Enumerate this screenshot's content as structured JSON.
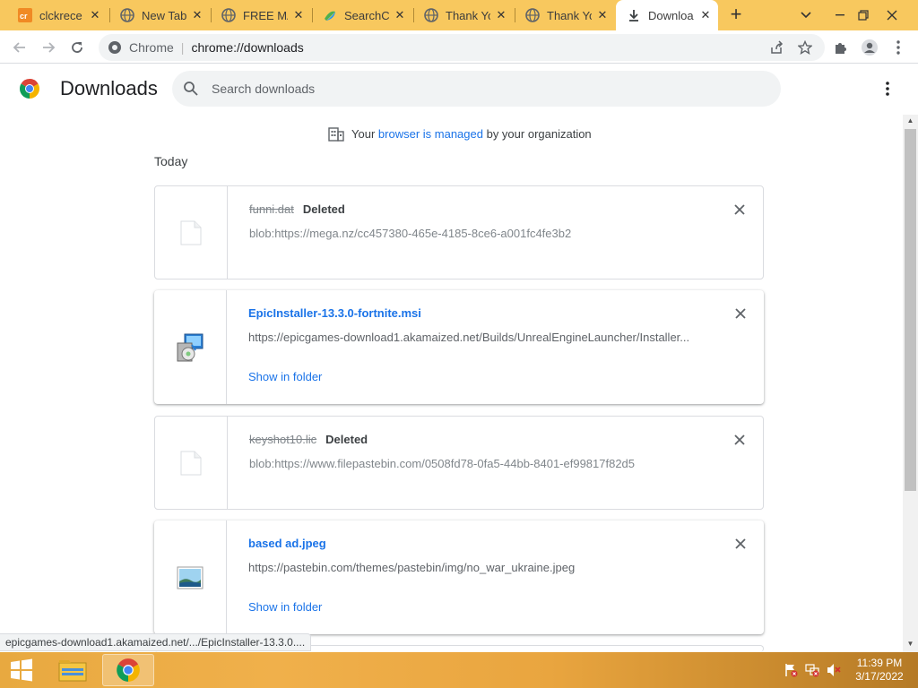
{
  "tabs": [
    {
      "title": "clckrece",
      "favicon": "cr-icon"
    },
    {
      "title": "New Tab",
      "favicon": "globe-icon"
    },
    {
      "title": "FREE MA",
      "favicon": "globe-icon"
    },
    {
      "title": "SearchCo",
      "favicon": "searchco-icon"
    },
    {
      "title": "Thank Yo",
      "favicon": "globe-icon"
    },
    {
      "title": "Thank Yo",
      "favicon": "globe-icon"
    },
    {
      "title": "Downloa",
      "favicon": "download-icon",
      "active": true
    }
  ],
  "omnibox": {
    "scheme_label": "Chrome",
    "separator": "|",
    "url": "chrome://downloads"
  },
  "header": {
    "title": "Downloads",
    "search_placeholder": "Search downloads"
  },
  "managed": {
    "prefix": "Your",
    "link": "browser is managed",
    "suffix": "by your organization"
  },
  "section_label": "Today",
  "downloads": [
    {
      "filename": "funni.dat",
      "status": "Deleted",
      "source": "blob:https://mega.nz/cc457380-465e-4185-8ce6-a001fc4fe3b2",
      "icon": "blank-file-icon"
    },
    {
      "filename": "EpicInstaller-13.3.0-fortnite.msi",
      "source": "https://epicgames-download1.akamaized.net/Builds/UnrealEngineLauncher/Installer...",
      "action": "Show in folder",
      "icon": "installer-icon"
    },
    {
      "filename": "keyshot10.lic",
      "status": "Deleted",
      "source": "blob:https://www.filepastebin.com/0508fd78-0fa5-44bb-8401-ef99817f82d5",
      "icon": "blank-file-icon"
    },
    {
      "filename": "based ad.jpeg",
      "source": "https://pastebin.com/themes/pastebin/img/no_war_ukraine.jpeg",
      "action": "Show in folder",
      "icon": "image-file-icon"
    }
  ],
  "status_bubble": "epicgames-download1.akamaized.net/.../EpicInstaller-13.3.0....",
  "taskbar": {
    "time": "11:39 PM",
    "date": "3/17/2022"
  },
  "colors": {
    "tabstrip": "#f8c85e",
    "link": "#1a73e8",
    "taskbar": "#e8a940"
  }
}
